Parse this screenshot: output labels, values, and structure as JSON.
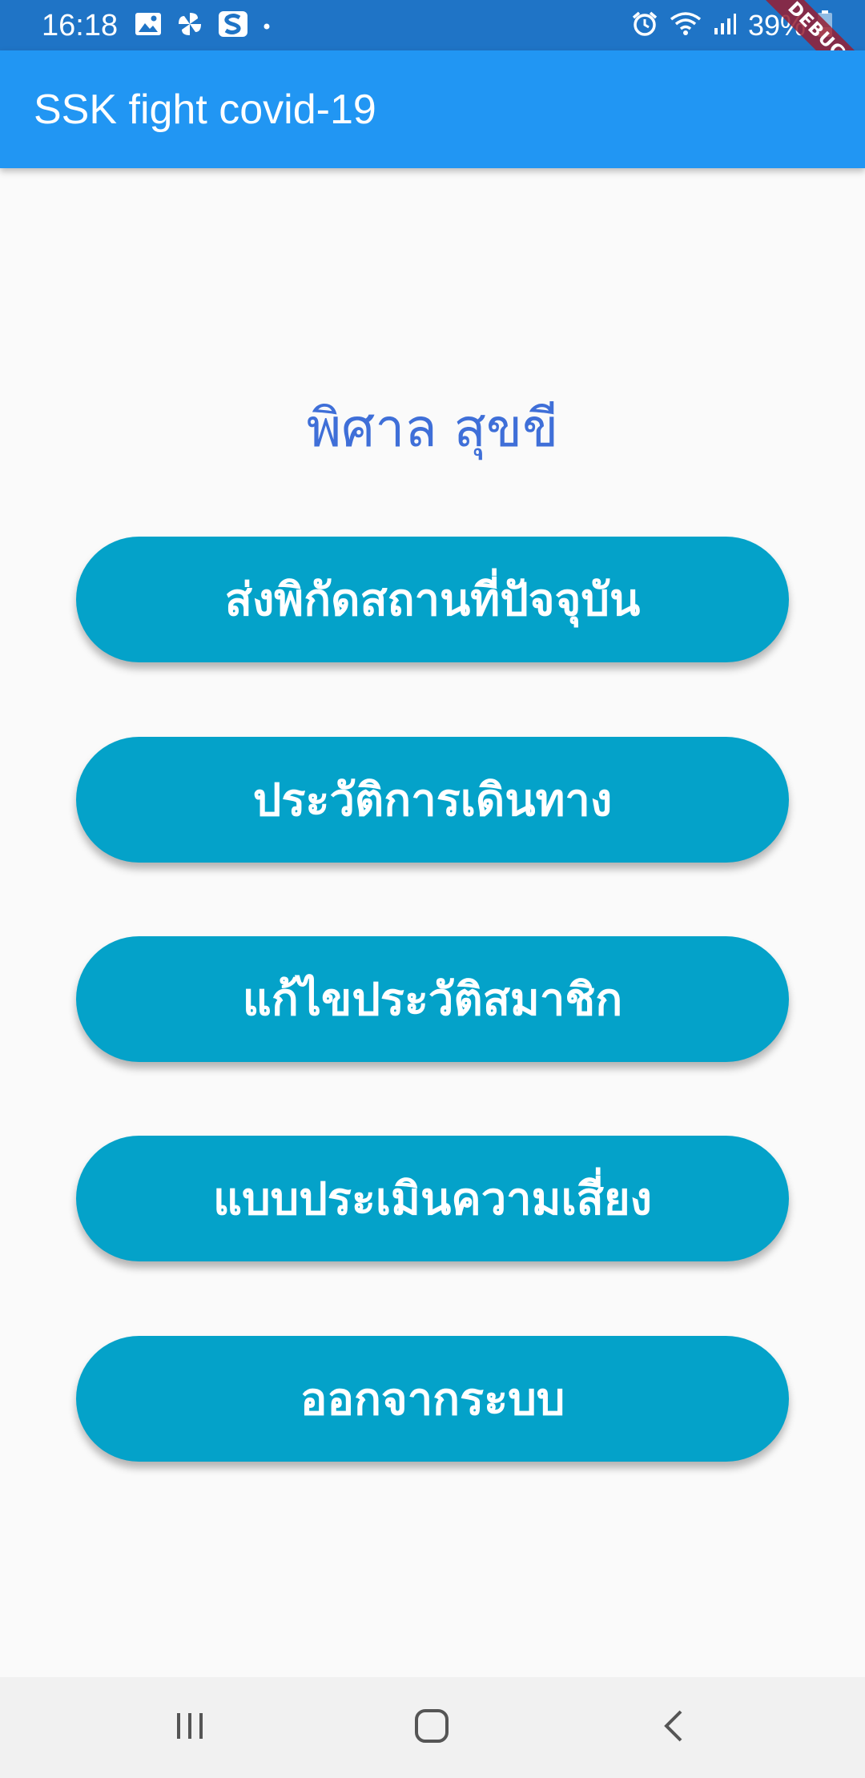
{
  "status_bar": {
    "time": "16:18",
    "battery_percent": "39%",
    "left_icons": [
      "image-icon",
      "pinwheel-icon",
      "s-app-icon",
      "dot-icon"
    ],
    "right_icons": [
      "alarm-icon",
      "wifi-icon",
      "signal-icon",
      "battery-icon"
    ]
  },
  "debug_banner": "DEBUG",
  "app_bar": {
    "title": "SSK fight covid-19"
  },
  "main": {
    "user_name": "พิศาล สุขขี",
    "buttons": [
      "ส่งพิกัดสถานที่ปัจจุบัน",
      "ประวัติการเดินทาง",
      "แก้ไขประวัติสมาชิก",
      "แบบประเมินความเสี่ยง",
      "ออกจากระบบ"
    ]
  },
  "colors": {
    "status_bar": "#1f74c6",
    "app_bar": "#2196f3",
    "button": "#04a2c9",
    "name_text": "#3f6fd8",
    "background": "#fafafa"
  },
  "nav_bar": {
    "icons": [
      "recent-apps-icon",
      "home-icon",
      "back-icon"
    ]
  }
}
